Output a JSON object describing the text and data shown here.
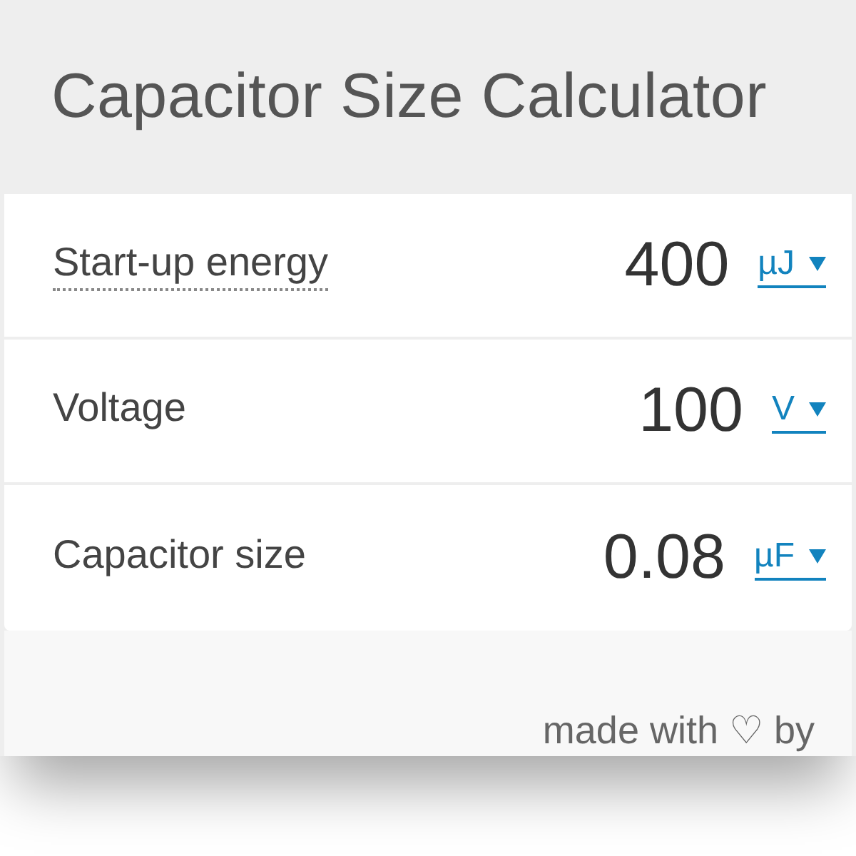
{
  "title": "Capacitor Size Calculator",
  "rows": [
    {
      "label": "Start-up energy",
      "has_info": true,
      "value": "400",
      "unit": "µJ"
    },
    {
      "label": "Voltage",
      "has_info": false,
      "value": "100",
      "unit": "V"
    },
    {
      "label": "Capacitor size",
      "has_info": false,
      "value": "0.08",
      "unit": "µF"
    }
  ],
  "footer": "made with ♡ by"
}
